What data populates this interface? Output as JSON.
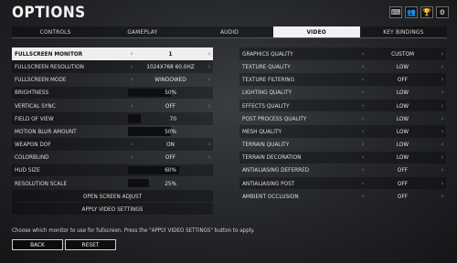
{
  "header": {
    "title": "OPTIONS",
    "icons": [
      "keyboard-icon",
      "friends-icon",
      "trophy-icon",
      "settings-icon"
    ]
  },
  "tabs": [
    {
      "label": "CONTROLS",
      "active": false
    },
    {
      "label": "GAMEPLAY",
      "active": false
    },
    {
      "label": "AUDIO",
      "active": false
    },
    {
      "label": "VIDEO",
      "active": true
    },
    {
      "label": "KEY BINDINGS",
      "active": false
    }
  ],
  "left": {
    "rows": [
      {
        "label": "FULLSCREEN MONITOR",
        "value": "1",
        "type": "select"
      },
      {
        "label": "FULLSCREEN RESOLUTION",
        "value": "1024x768 60.0Hz",
        "type": "select"
      },
      {
        "label": "FULLSCREEN MODE",
        "value": "WINDOWED",
        "type": "select"
      },
      {
        "label": "BRIGHTNESS",
        "value": "50%",
        "type": "slider",
        "level": 0.5
      },
      {
        "label": "VERTICAL SYNC",
        "value": "OFF",
        "type": "select"
      },
      {
        "label": "FIELD OF VIEW",
        "value": "70",
        "type": "slider",
        "level": 0.15
      },
      {
        "label": "MOTION BLUR AMOUNT",
        "value": "50%",
        "type": "slider",
        "level": 0.5
      },
      {
        "label": "WEAPON DOF",
        "value": "ON",
        "type": "select"
      },
      {
        "label": "COLORBLIND",
        "value": "OFF",
        "type": "select"
      },
      {
        "label": "HUD SIZE",
        "value": "60%",
        "type": "slider",
        "level": 0.6
      },
      {
        "label": "RESOLUTION SCALE",
        "value": "25%",
        "type": "slider",
        "level": 0.25
      }
    ],
    "buttons": [
      "OPEN SCREEN ADJUST",
      "APPLY VIDEO SETTINGS"
    ]
  },
  "right": {
    "rows": [
      {
        "label": "GRAPHICS QUALITY",
        "value": "CUSTOM"
      },
      {
        "label": "TEXTURE QUALITY",
        "value": "LOW"
      },
      {
        "label": "TEXTURE FILTERING",
        "value": "OFF"
      },
      {
        "label": "LIGHTING QUALITY",
        "value": "LOW"
      },
      {
        "label": "EFFECTS QUALITY",
        "value": "LOW"
      },
      {
        "label": "POST PROCESS QUALITY",
        "value": "LOW"
      },
      {
        "label": "MESH QUALITY",
        "value": "LOW"
      },
      {
        "label": "TERRAIN QUALITY",
        "value": "LOW"
      },
      {
        "label": "TERRAIN DECORATION",
        "value": "LOW"
      },
      {
        "label": "ANTIALIASING DEFERRED",
        "value": "OFF"
      },
      {
        "label": "ANTIALIASING POST",
        "value": "OFF"
      },
      {
        "label": "AMBIENT OCCLUSION",
        "value": "OFF"
      }
    ]
  },
  "hint": "Choose which monitor to use for fullscreen. Press the \"APPLY VIDEO SETTINGS\" button to apply.",
  "footer": {
    "back_label": "BACK",
    "reset_label": "RESET"
  }
}
